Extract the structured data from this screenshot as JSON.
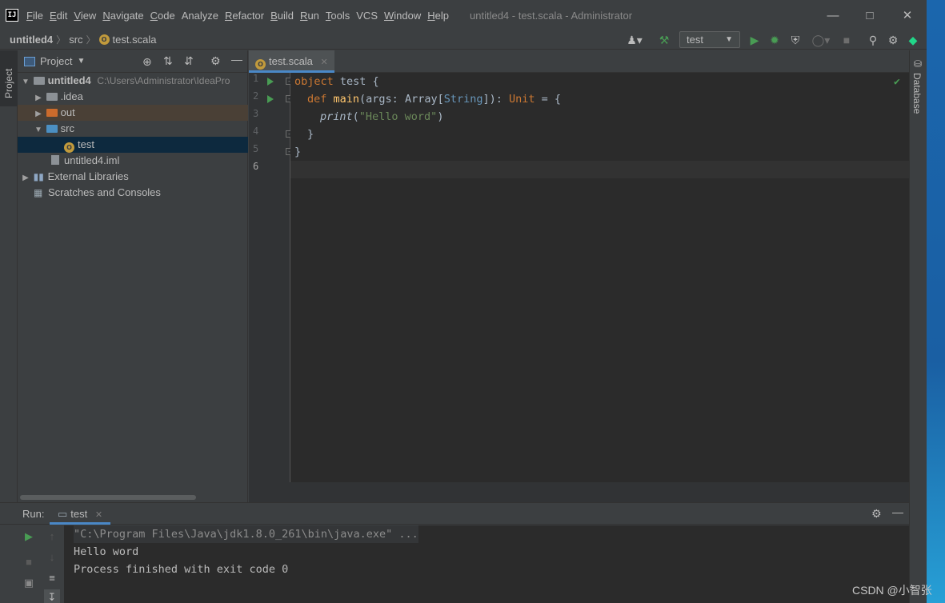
{
  "titlebar": {
    "menu": [
      {
        "label": "File",
        "mnemonic": "F",
        "rest": "ile"
      },
      {
        "label": "Edit",
        "mnemonic": "E",
        "rest": "dit"
      },
      {
        "label": "View",
        "mnemonic": "V",
        "rest": "iew"
      },
      {
        "label": "Navigate",
        "mnemonic": "N",
        "rest": "avigate"
      },
      {
        "label": "Code",
        "mnemonic": "C",
        "rest": "ode"
      },
      {
        "label": "Analyze",
        "mnemonic": "",
        "rest": "Analyze"
      },
      {
        "label": "Refactor",
        "mnemonic": "R",
        "rest": "efactor"
      },
      {
        "label": "Build",
        "mnemonic": "B",
        "rest": "uild"
      },
      {
        "label": "Run",
        "mnemonic": "R",
        "rest": "un"
      },
      {
        "label": "Tools",
        "mnemonic": "T",
        "rest": "ools"
      },
      {
        "label": "VCS",
        "mnemonic": "",
        "rest": "VCS"
      },
      {
        "label": "Window",
        "mnemonic": "W",
        "rest": "indow"
      },
      {
        "label": "Help",
        "mnemonic": "H",
        "rest": "elp"
      }
    ],
    "title": "untitled4 - test.scala - Administrator",
    "logo_text": "IJ"
  },
  "navbar": {
    "project": "untitled4",
    "folder": "src",
    "file": "test.scala",
    "run_config": "test"
  },
  "project_panel": {
    "title": "Project",
    "strip_label": "Project",
    "tree": [
      {
        "label": "untitled4",
        "extra": "C:\\Users\\Administrator\\IdeaPro"
      },
      {
        "label": ".idea"
      },
      {
        "label": "out"
      },
      {
        "label": "src"
      },
      {
        "label": "test"
      },
      {
        "label": "untitled4.iml"
      },
      {
        "label": "External Libraries"
      },
      {
        "label": "Scratches and Consoles"
      }
    ]
  },
  "editor": {
    "tab": "test.scala",
    "line_numbers": [
      "1",
      "2",
      "3",
      "4",
      "5",
      "6"
    ],
    "code": {
      "l1_kw": "object",
      "l1_rest": " test {",
      "l2_kw": "def",
      "l2_fn": "main",
      "l2_a": "(args: Array[",
      "l2_type": "String",
      "l2_b": "]): ",
      "l2_unit": "Unit",
      "l2_c": " = {",
      "l3_fn": "print",
      "l3_a": "(",
      "l3_str": "\"Hello word\"",
      "l3_b": ")",
      "l4": "}",
      "l5": "}"
    }
  },
  "right_strip": {
    "label": "Database"
  },
  "run_panel": {
    "label": "Run:",
    "tab": "test",
    "console": [
      "\"C:\\Program Files\\Java\\jdk1.8.0_261\\bin\\java.exe\" ...",
      "Hello word",
      "Process finished with exit code 0"
    ]
  },
  "watermark": "CSDN @小智张",
  "colors": {
    "editor_bg": "#2b2b2b",
    "panel_bg": "#3c3f41",
    "keyword": "#cc7832",
    "string": "#6a8759",
    "function": "#ffc66d",
    "accent": "#4a88c7",
    "run_green": "#499c54"
  }
}
